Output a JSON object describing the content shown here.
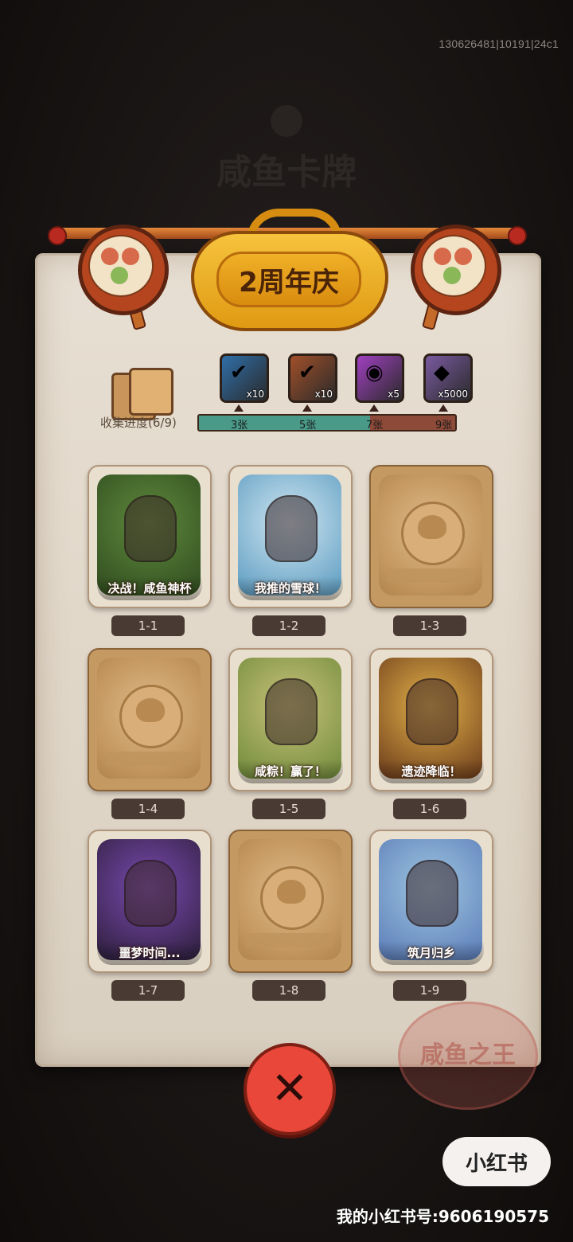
{
  "build_id": "130626481|10191|24c1",
  "background_title": "咸鱼卡牌",
  "banner": {
    "title": "2周年庆"
  },
  "progress": {
    "label": "收集进度(6/9)",
    "collected": 6,
    "total": 9,
    "milestones": [
      {
        "tick": "3张",
        "reward_qty": "x10",
        "icon": "treasure-chest-icon",
        "color": "#2f6fa8"
      },
      {
        "tick": "5张",
        "reward_qty": "x10",
        "icon": "treasure-chest-icon",
        "color": "#a1502a"
      },
      {
        "tick": "7张",
        "reward_qty": "x5",
        "icon": "swirl-orb-icon",
        "color": "#a040c0"
      },
      {
        "tick": "9张",
        "reward_qty": "x5000",
        "icon": "diamond-icon",
        "color": "#7a5aa0"
      }
    ]
  },
  "cards": [
    {
      "id": "1-1",
      "title": "决战！咸鱼神杯",
      "locked": false,
      "icon": "soccer-fish-icon",
      "bg": [
        "#5f8a3c",
        "#2f4a1f"
      ]
    },
    {
      "id": "1-2",
      "title": "我推的雪球！",
      "locked": false,
      "icon": "snowball-fish-icon",
      "bg": [
        "#cfe6f2",
        "#5a9abf"
      ]
    },
    {
      "id": "1-3",
      "title": "",
      "locked": true,
      "icon": "locked-fish-icon"
    },
    {
      "id": "1-4",
      "title": "",
      "locked": true,
      "icon": "locked-fish-icon"
    },
    {
      "id": "1-5",
      "title": "咸粽！赢了！",
      "locked": false,
      "icon": "zongzi-fish-icon",
      "bg": [
        "#c8c27a",
        "#6f8a3a"
      ]
    },
    {
      "id": "1-6",
      "title": "遗迹降临！",
      "locked": false,
      "icon": "ruins-fish-icon",
      "bg": [
        "#e3b24a",
        "#6a3a1a"
      ]
    },
    {
      "id": "1-7",
      "title": "噩梦时间...",
      "locked": false,
      "icon": "nightmare-fish-icon",
      "bg": [
        "#7a4ab0",
        "#2c1e3a"
      ]
    },
    {
      "id": "1-8",
      "title": "",
      "locked": true,
      "icon": "locked-fish-icon"
    },
    {
      "id": "1-9",
      "title": "筑月归乡",
      "locked": false,
      "icon": "pagoda-fish-icon",
      "bg": [
        "#9fc6e0",
        "#5a7bb8"
      ]
    }
  ],
  "seal_text": "咸鱼之王",
  "close_label": "✕",
  "watermark": {
    "app": "小红书",
    "account": "我的小红书号:9606190575"
  }
}
